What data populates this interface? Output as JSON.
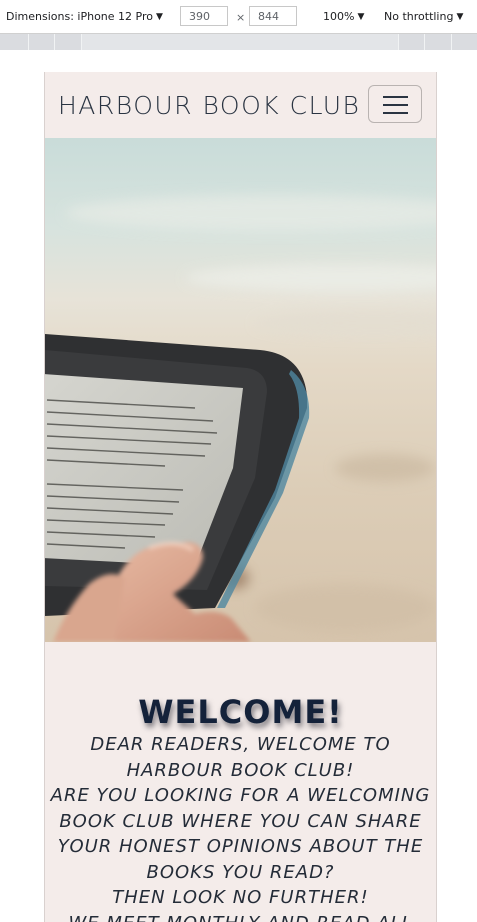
{
  "devtools": {
    "dimensions_label": "Dimensions: iPhone 12 Pro",
    "width": "390",
    "times": "×",
    "height": "844",
    "zoom": "100%",
    "throttling": "No throttling"
  },
  "site": {
    "brand": "HARBOUR BOOK CLUB",
    "menu_icon": "hamburger-menu-icon",
    "hero_image": "hand holding e-reader on beach"
  },
  "welcome": {
    "heading": "WELCOME!",
    "lines": [
      "DEAR READERS, WELCOME TO HARBOUR BOOK CLUB!",
      "ARE YOU LOOKING FOR A WELCOMING BOOK CLUB WHERE YOU CAN SHARE YOUR HONEST OPINIONS ABOUT THE BOOKS YOU READ?",
      "THEN LOOK NO FURTHER!",
      "WE MEET MONTHLY AND READ ALL"
    ]
  },
  "colors": {
    "page_background": "#f4ecea",
    "text_dark": "#2a3442",
    "heading": "#14223a"
  }
}
